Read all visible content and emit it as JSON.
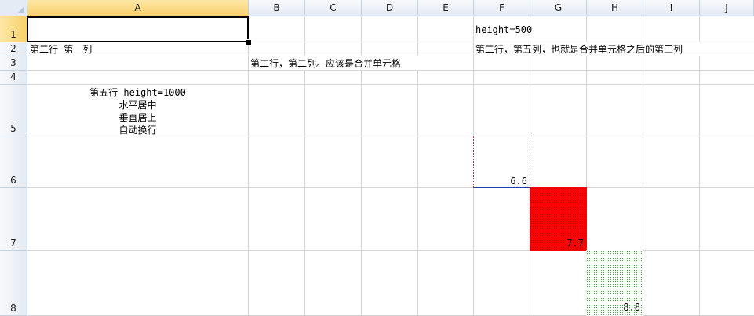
{
  "columns": [
    "A",
    "B",
    "C",
    "D",
    "E",
    "F",
    "G",
    "H",
    "I",
    "J"
  ],
  "rows": [
    "1",
    "2",
    "3",
    "4",
    "5",
    "6",
    "7",
    "8"
  ],
  "selected_column": "A",
  "selected_row": "1",
  "cells": {
    "F1": "height=500",
    "A2": "第二行 第一列",
    "F2": "第二行，第五列，也就是合并单元格之后的第三列",
    "B3": "第二行，第二列。应该是合并单元格",
    "A5_line1": "第五行 height=1000",
    "A5_line2": "水平居中",
    "A5_line3": "垂直居上",
    "A5_line4": "自动换行",
    "F6": "6.6",
    "G7": "7.7",
    "H8": "8.8"
  },
  "colors": {
    "fill_G7": "#ff0000",
    "fill_H8_pattern": "#4fa84f",
    "border_F6_bottom": "#1f3fa8"
  }
}
